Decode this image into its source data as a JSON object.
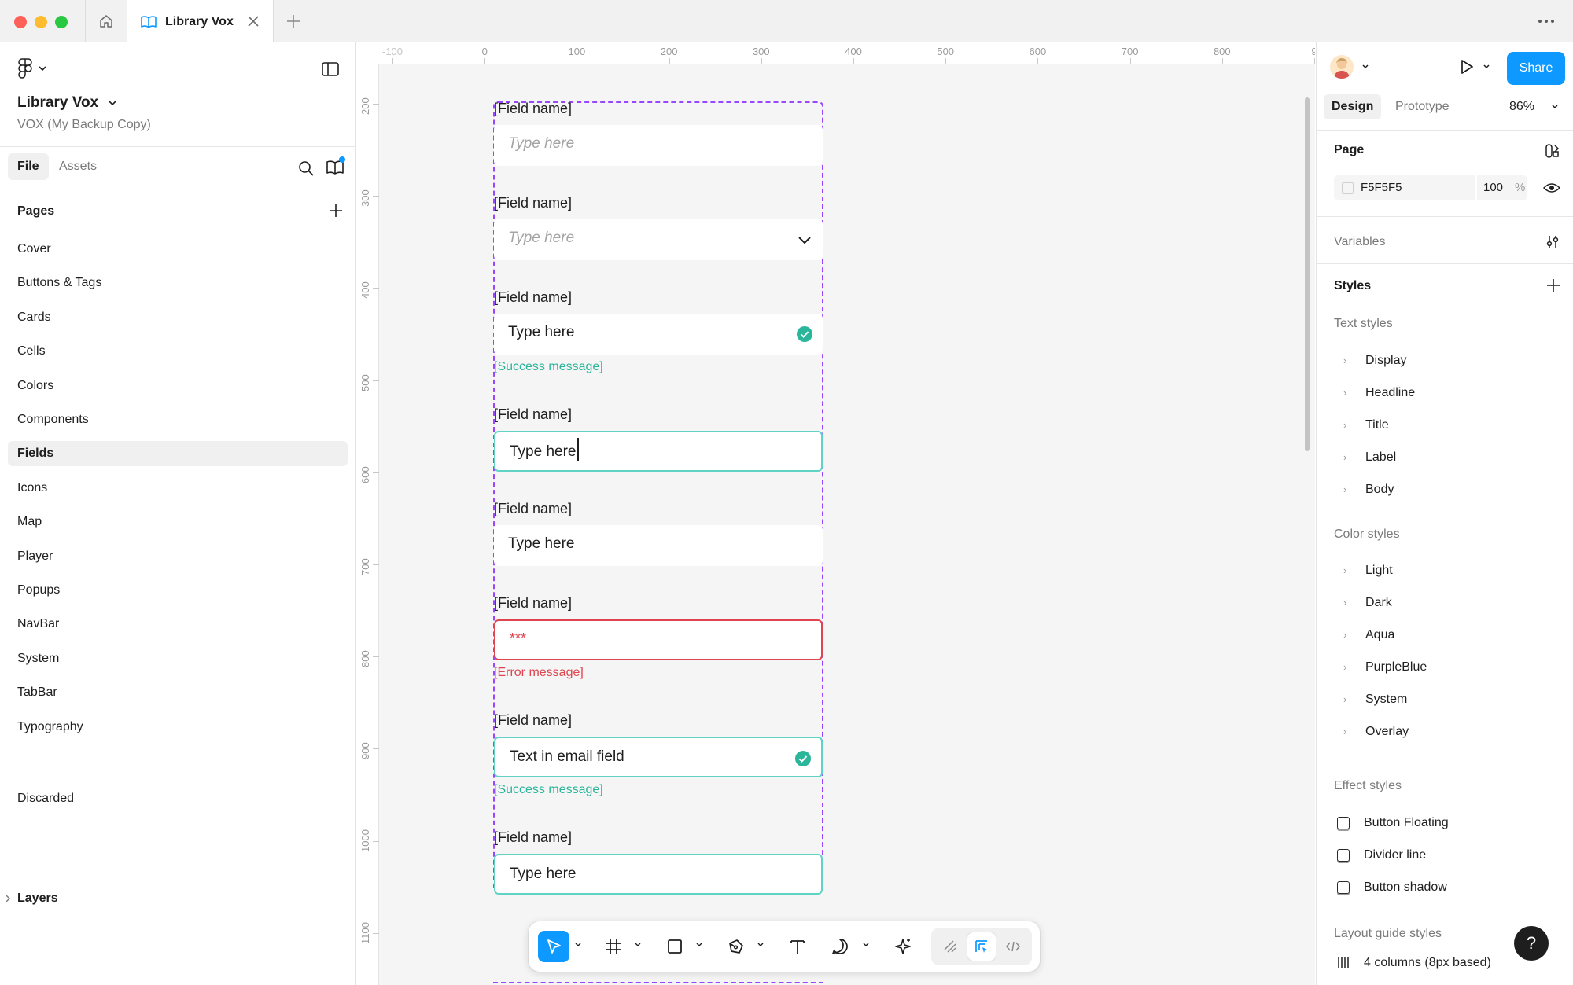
{
  "titlebar": {
    "tab_title": "Library Vox"
  },
  "left_sidebar": {
    "file_name": "Library Vox",
    "file_subtitle": "VOX (My Backup Copy)",
    "tabs": {
      "file": "File",
      "assets": "Assets"
    },
    "pages_title": "Pages",
    "pages": [
      {
        "label": "Cover"
      },
      {
        "label": "Buttons & Tags"
      },
      {
        "label": "Cards"
      },
      {
        "label": "Cells"
      },
      {
        "label": "Colors"
      },
      {
        "label": "Components"
      },
      {
        "label": "Fields",
        "active": true
      },
      {
        "label": "Icons"
      },
      {
        "label": "Map"
      },
      {
        "label": "Player"
      },
      {
        "label": "Popups"
      },
      {
        "label": "NavBar"
      },
      {
        "label": "System"
      },
      {
        "label": "TabBar"
      },
      {
        "label": "Typography"
      }
    ],
    "discarded_page": "Discarded",
    "layers_title": "Layers"
  },
  "canvas": {
    "ruler_top": [
      "-100",
      "0",
      "100",
      "200",
      "300",
      "400",
      "500",
      "600",
      "700",
      "800",
      "9"
    ],
    "ruler_left": [
      "200",
      "300",
      "400",
      "500",
      "600",
      "700",
      "800",
      "900",
      "1000",
      "1100"
    ],
    "fields": [
      {
        "label": "[Field name]",
        "value": "Type here",
        "variant": "placeholder"
      },
      {
        "label": "[Field name]",
        "value": "Type here",
        "variant": "dropdown"
      },
      {
        "label": "[Field name]",
        "value": "Type here",
        "variant": "success",
        "message": "[Success message]"
      },
      {
        "label": "[Field name]",
        "value": "Type here",
        "variant": "focused"
      },
      {
        "label": "[Field name]",
        "value": "Type here",
        "variant": "filled"
      },
      {
        "label": "[Field name]",
        "value": "***",
        "variant": "error",
        "message": "[Error message]"
      },
      {
        "label": "[Field name]",
        "value": "Text in email field",
        "variant": "success-focused",
        "message": "[Success message]"
      },
      {
        "label": "[Field name]",
        "value": "Type here",
        "variant": "focused-plain"
      }
    ],
    "colors": {
      "frame": "#9747ff",
      "success": "#2bb59a",
      "error": "#e0454f",
      "focus": "#5fd4c4"
    }
  },
  "toolbar": {
    "tools": [
      "move-tool",
      "frame-tool",
      "rectangle-tool",
      "pen-tool",
      "text-tool",
      "comment-tool",
      "actions-tool"
    ],
    "modes": [
      "draw-mode",
      "design-mode",
      "dev-mode"
    ]
  },
  "right_panel": {
    "share_label": "Share",
    "tabs": {
      "design": "Design",
      "prototype": "Prototype"
    },
    "zoom": "86%",
    "page_section": "Page",
    "page_color_hex": "F5F5F5",
    "page_opacity": "100",
    "page_opacity_unit": "%",
    "variables_section": "Variables",
    "styles_section": "Styles",
    "text_styles_title": "Text styles",
    "text_styles": [
      "Display",
      "Headline",
      "Title",
      "Label",
      "Body"
    ],
    "color_styles_title": "Color styles",
    "color_styles": [
      "Light",
      "Dark",
      "Aqua",
      "PurpleBlue",
      "System",
      "Overlay"
    ],
    "effect_styles_title": "Effect styles",
    "effect_styles": [
      "Button Floating",
      "Divider line",
      "Button shadow"
    ],
    "layout_guide_title": "Layout guide styles",
    "layout_guides": [
      "4 columns (8px based)"
    ],
    "help_label": "?"
  }
}
